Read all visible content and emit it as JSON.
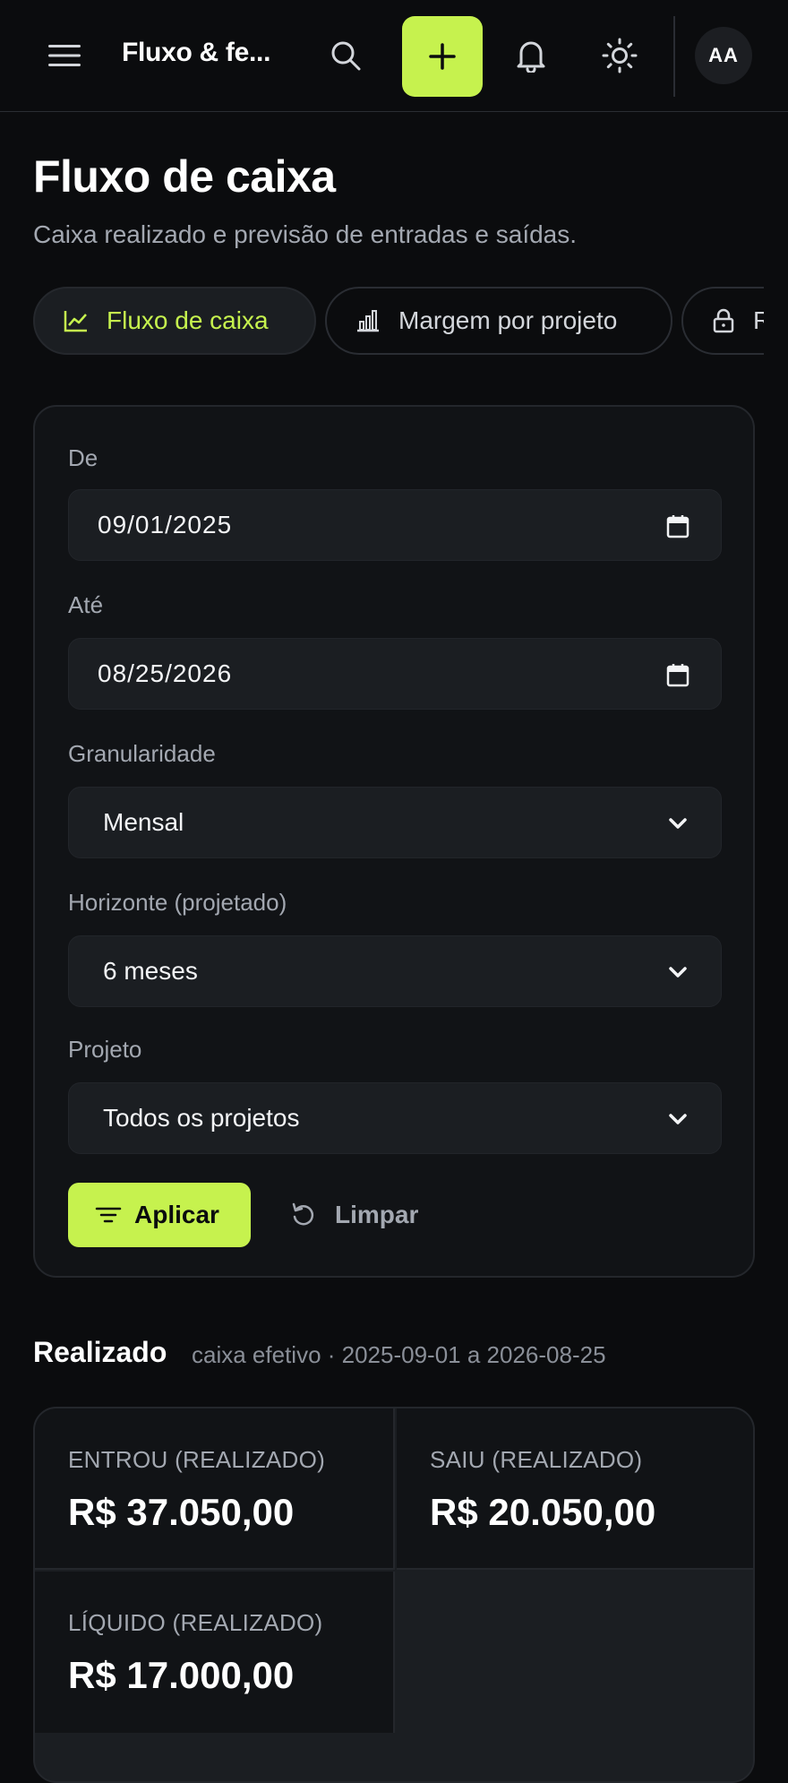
{
  "header": {
    "app_title": "Fluxo & fe...",
    "avatar_initials": "AA",
    "accent_color": "#c6f24e",
    "icons": [
      "menu-icon",
      "search-icon",
      "plus-icon",
      "bell-icon",
      "sun-icon"
    ]
  },
  "page": {
    "title": "Fluxo de caixa",
    "subtitle": "Caixa realizado e previsão de entradas e saídas."
  },
  "tabs": [
    {
      "label": "Fluxo de caixa",
      "icon": "line-chart-icon",
      "active": true
    },
    {
      "label": "Margem por projeto",
      "icon": "bar-chart-icon",
      "active": false
    },
    {
      "label": "R",
      "icon": "lock-icon",
      "active": false
    }
  ],
  "filters": {
    "from": {
      "label": "De",
      "value": "09/01/2025"
    },
    "to": {
      "label": "Até",
      "value": "08/25/2026"
    },
    "granularity": {
      "label": "Granularidade",
      "value": "Mensal"
    },
    "horizon": {
      "label": "Horizonte (projetado)",
      "value": "6 meses"
    },
    "project": {
      "label": "Projeto",
      "value": "Todos os projetos"
    },
    "apply_label": "Aplicar",
    "clear_label": "Limpar"
  },
  "realized": {
    "title": "Realizado",
    "meta": "caixa efetivo · 2025-09-01 a 2026-08-25",
    "stats": [
      {
        "label": "ENTROU (REALIZADO)",
        "value": "R$ 37.050,00"
      },
      {
        "label": "SAIU (REALIZADO)",
        "value": "R$ 20.050,00"
      },
      {
        "label": "LÍQUIDO (REALIZADO)",
        "value": "R$ 17.000,00"
      }
    ]
  }
}
